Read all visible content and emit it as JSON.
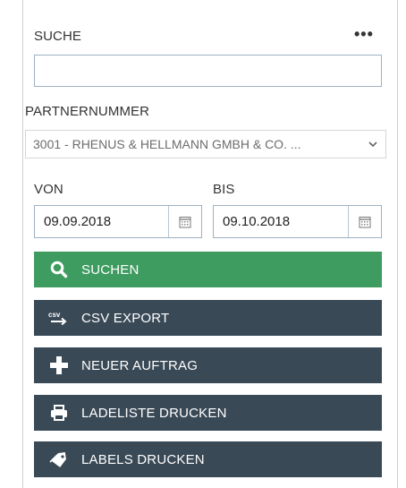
{
  "search": {
    "label": "SUCHE",
    "more_label": "•••",
    "value": "",
    "placeholder": ""
  },
  "partner": {
    "label": "PARTNERNUMMER",
    "selected": "3001 - RHENUS & HELLMANN GMBH & CO. ..."
  },
  "dates": {
    "from_label": "VON",
    "from_value": "09.09.2018",
    "to_label": "BIS",
    "to_value": "09.10.2018"
  },
  "actions": {
    "search": "SUCHEN",
    "csv_export": "CSV EXPORT",
    "new_order": "NEUER AUFTRAG",
    "print_loading_list": "LADELISTE DRUCKEN",
    "print_labels": "LABELS DRUCKEN"
  },
  "icons": {
    "more": "more-horizontal-icon",
    "chevron": "chevron-down-icon",
    "calendar": "calendar-icon",
    "search": "magnifier-icon",
    "csv": "csv-icon",
    "plus": "plus-icon",
    "print": "printer-icon",
    "label": "tag-icon"
  },
  "colors": {
    "primary_dark": "#394956",
    "success": "#3f9c61",
    "border": "#9eb1c4"
  }
}
